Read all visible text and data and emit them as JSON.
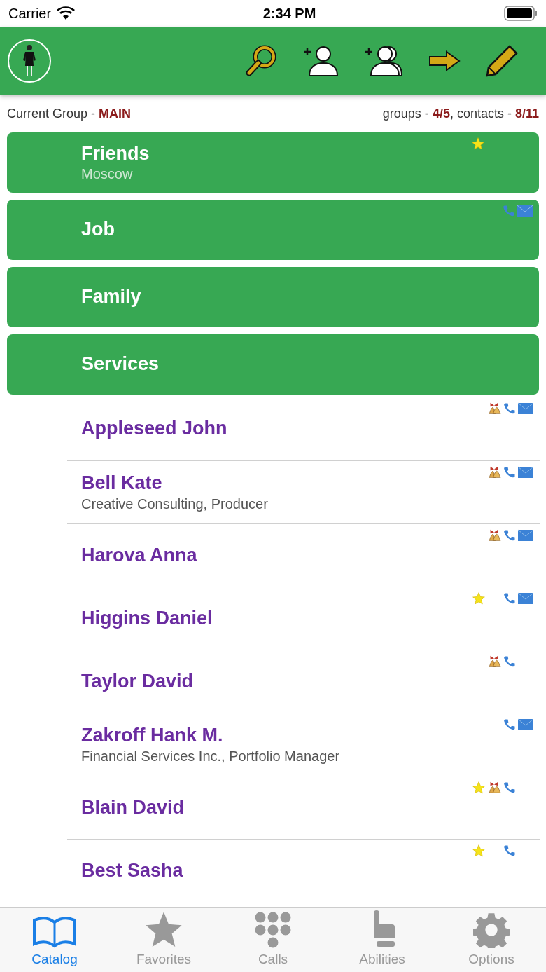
{
  "status_bar": {
    "carrier": "Carrier",
    "time": "2:34 PM"
  },
  "info": {
    "group_label": "Current Group - ",
    "group": "MAIN",
    "groups_label": "groups - ",
    "groups": "4/5",
    "contacts_label": ", contacts - ",
    "contacts": "8/11"
  },
  "groups": [
    {
      "name": "Friends",
      "subtitle": "Moscow",
      "star": true,
      "bell": false,
      "phone": false,
      "mail": false
    },
    {
      "name": "Job",
      "star": false,
      "bell": false,
      "phone": true,
      "mail": true
    },
    {
      "name": "Family",
      "star": false,
      "bell": false,
      "phone": false,
      "mail": false
    },
    {
      "name": "Services",
      "star": false,
      "bell": false,
      "phone": false,
      "mail": false
    }
  ],
  "contacts": [
    {
      "name": "Appleseed John",
      "star": false,
      "bell": true,
      "phone": true,
      "mail": true
    },
    {
      "name": "Bell Kate",
      "subtitle": "Creative Consulting, Producer",
      "star": false,
      "bell": true,
      "phone": true,
      "mail": true
    },
    {
      "name": "Harova Anna",
      "star": false,
      "bell": true,
      "phone": true,
      "mail": true
    },
    {
      "name": "Higgins Daniel",
      "star": true,
      "bell": false,
      "phone": true,
      "mail": true
    },
    {
      "name": "Taylor David",
      "star": false,
      "bell": true,
      "phone": true,
      "mail": false
    },
    {
      "name": "Zakroff Hank M.",
      "subtitle": "Financial Services Inc., Portfolio Manager",
      "star": false,
      "bell": false,
      "phone": true,
      "mail": true
    },
    {
      "name": "Blain David",
      "star": true,
      "bell": true,
      "phone": true,
      "mail": false
    },
    {
      "name": "Best Sasha",
      "star": true,
      "bell": false,
      "phone": true,
      "mail": false
    }
  ],
  "tabs": [
    {
      "label": "Catalog",
      "kind": "book",
      "selected": true
    },
    {
      "label": "Favorites",
      "kind": "star",
      "selected": false
    },
    {
      "label": "Calls",
      "kind": "dial",
      "selected": false
    },
    {
      "label": "Abilities",
      "kind": "hand",
      "selected": false
    },
    {
      "label": "Options",
      "kind": "gear",
      "selected": false
    }
  ]
}
